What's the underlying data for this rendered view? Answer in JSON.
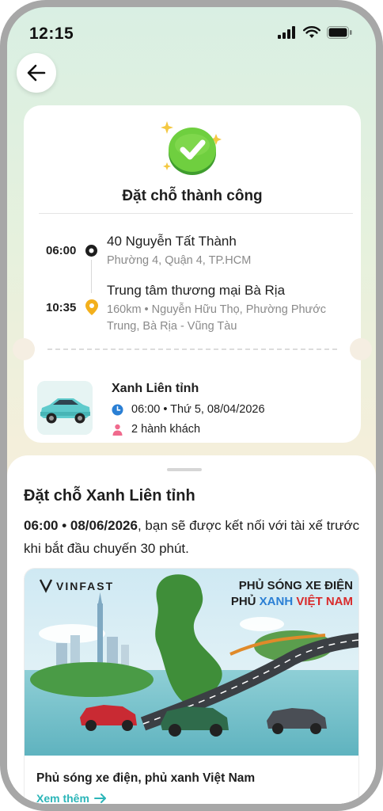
{
  "status_bar": {
    "time": "12:15",
    "icons": [
      "signal-icon",
      "wifi-icon",
      "battery-icon"
    ]
  },
  "nav": {
    "back_icon": "arrow-left-icon"
  },
  "booking": {
    "title": "Đặt chỗ thành công",
    "pickup": {
      "time": "06:00",
      "title": "40 Nguyễn Tất Thành",
      "subtitle": "Phường 4, Quận 4, TP.HCM"
    },
    "dropoff": {
      "time": "10:35",
      "title": "Trung tâm thương mại Bà Rịa",
      "subtitle": "160km • Nguyễn Hữu Thọ, Phường Phước Trung, Bà Rịa - Vũng Tàu"
    },
    "service": {
      "name": "Xanh Liên tỉnh",
      "schedule": "06:00 • Thứ 5, 08/04/2026",
      "passengers": "2 hành khách"
    }
  },
  "sheet": {
    "title": "Đặt chỗ Xanh Liên tỉnh",
    "desc_bold": "06:00 • 08/06/2026",
    "desc_rest": ", bạn sẽ được kết nối với tài xế trước khi bắt đầu chuyến 30 phút.",
    "promo": {
      "brand": "VINFAST",
      "headline_line1": "PHỦ SÓNG XE ĐIỆN",
      "headline_line2_a": "PHỦ ",
      "headline_line2_b": "XANH ",
      "headline_line2_c": "VIỆT NAM",
      "title": "Phủ sóng xe điện, phủ xanh Việt Nam",
      "see_more": "Xem thêm"
    }
  },
  "colors": {
    "accent": "#2bb5b8",
    "success": "#5cc23a",
    "pin": "#f3b01c",
    "clock": "#2a7fd4",
    "person": "#f06a8d"
  }
}
